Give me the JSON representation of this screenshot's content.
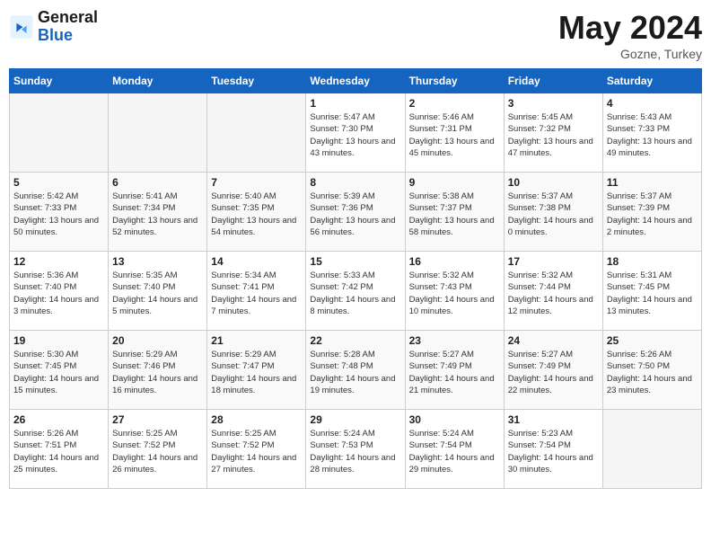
{
  "logo": {
    "general": "General",
    "blue": "Blue"
  },
  "title": {
    "month_year": "May 2024",
    "location": "Gozne, Turkey"
  },
  "days_of_week": [
    "Sunday",
    "Monday",
    "Tuesday",
    "Wednesday",
    "Thursday",
    "Friday",
    "Saturday"
  ],
  "weeks": [
    [
      {
        "day": "",
        "empty": true
      },
      {
        "day": "",
        "empty": true
      },
      {
        "day": "",
        "empty": true
      },
      {
        "day": "1",
        "sunrise": "Sunrise: 5:47 AM",
        "sunset": "Sunset: 7:30 PM",
        "daylight": "Daylight: 13 hours and 43 minutes."
      },
      {
        "day": "2",
        "sunrise": "Sunrise: 5:46 AM",
        "sunset": "Sunset: 7:31 PM",
        "daylight": "Daylight: 13 hours and 45 minutes."
      },
      {
        "day": "3",
        "sunrise": "Sunrise: 5:45 AM",
        "sunset": "Sunset: 7:32 PM",
        "daylight": "Daylight: 13 hours and 47 minutes."
      },
      {
        "day": "4",
        "sunrise": "Sunrise: 5:43 AM",
        "sunset": "Sunset: 7:33 PM",
        "daylight": "Daylight: 13 hours and 49 minutes."
      }
    ],
    [
      {
        "day": "5",
        "sunrise": "Sunrise: 5:42 AM",
        "sunset": "Sunset: 7:33 PM",
        "daylight": "Daylight: 13 hours and 50 minutes."
      },
      {
        "day": "6",
        "sunrise": "Sunrise: 5:41 AM",
        "sunset": "Sunset: 7:34 PM",
        "daylight": "Daylight: 13 hours and 52 minutes."
      },
      {
        "day": "7",
        "sunrise": "Sunrise: 5:40 AM",
        "sunset": "Sunset: 7:35 PM",
        "daylight": "Daylight: 13 hours and 54 minutes."
      },
      {
        "day": "8",
        "sunrise": "Sunrise: 5:39 AM",
        "sunset": "Sunset: 7:36 PM",
        "daylight": "Daylight: 13 hours and 56 minutes."
      },
      {
        "day": "9",
        "sunrise": "Sunrise: 5:38 AM",
        "sunset": "Sunset: 7:37 PM",
        "daylight": "Daylight: 13 hours and 58 minutes."
      },
      {
        "day": "10",
        "sunrise": "Sunrise: 5:37 AM",
        "sunset": "Sunset: 7:38 PM",
        "daylight": "Daylight: 14 hours and 0 minutes."
      },
      {
        "day": "11",
        "sunrise": "Sunrise: 5:37 AM",
        "sunset": "Sunset: 7:39 PM",
        "daylight": "Daylight: 14 hours and 2 minutes."
      }
    ],
    [
      {
        "day": "12",
        "sunrise": "Sunrise: 5:36 AM",
        "sunset": "Sunset: 7:40 PM",
        "daylight": "Daylight: 14 hours and 3 minutes."
      },
      {
        "day": "13",
        "sunrise": "Sunrise: 5:35 AM",
        "sunset": "Sunset: 7:40 PM",
        "daylight": "Daylight: 14 hours and 5 minutes."
      },
      {
        "day": "14",
        "sunrise": "Sunrise: 5:34 AM",
        "sunset": "Sunset: 7:41 PM",
        "daylight": "Daylight: 14 hours and 7 minutes."
      },
      {
        "day": "15",
        "sunrise": "Sunrise: 5:33 AM",
        "sunset": "Sunset: 7:42 PM",
        "daylight": "Daylight: 14 hours and 8 minutes."
      },
      {
        "day": "16",
        "sunrise": "Sunrise: 5:32 AM",
        "sunset": "Sunset: 7:43 PM",
        "daylight": "Daylight: 14 hours and 10 minutes."
      },
      {
        "day": "17",
        "sunrise": "Sunrise: 5:32 AM",
        "sunset": "Sunset: 7:44 PM",
        "daylight": "Daylight: 14 hours and 12 minutes."
      },
      {
        "day": "18",
        "sunrise": "Sunrise: 5:31 AM",
        "sunset": "Sunset: 7:45 PM",
        "daylight": "Daylight: 14 hours and 13 minutes."
      }
    ],
    [
      {
        "day": "19",
        "sunrise": "Sunrise: 5:30 AM",
        "sunset": "Sunset: 7:45 PM",
        "daylight": "Daylight: 14 hours and 15 minutes."
      },
      {
        "day": "20",
        "sunrise": "Sunrise: 5:29 AM",
        "sunset": "Sunset: 7:46 PM",
        "daylight": "Daylight: 14 hours and 16 minutes."
      },
      {
        "day": "21",
        "sunrise": "Sunrise: 5:29 AM",
        "sunset": "Sunset: 7:47 PM",
        "daylight": "Daylight: 14 hours and 18 minutes."
      },
      {
        "day": "22",
        "sunrise": "Sunrise: 5:28 AM",
        "sunset": "Sunset: 7:48 PM",
        "daylight": "Daylight: 14 hours and 19 minutes."
      },
      {
        "day": "23",
        "sunrise": "Sunrise: 5:27 AM",
        "sunset": "Sunset: 7:49 PM",
        "daylight": "Daylight: 14 hours and 21 minutes."
      },
      {
        "day": "24",
        "sunrise": "Sunrise: 5:27 AM",
        "sunset": "Sunset: 7:49 PM",
        "daylight": "Daylight: 14 hours and 22 minutes."
      },
      {
        "day": "25",
        "sunrise": "Sunrise: 5:26 AM",
        "sunset": "Sunset: 7:50 PM",
        "daylight": "Daylight: 14 hours and 23 minutes."
      }
    ],
    [
      {
        "day": "26",
        "sunrise": "Sunrise: 5:26 AM",
        "sunset": "Sunset: 7:51 PM",
        "daylight": "Daylight: 14 hours and 25 minutes."
      },
      {
        "day": "27",
        "sunrise": "Sunrise: 5:25 AM",
        "sunset": "Sunset: 7:52 PM",
        "daylight": "Daylight: 14 hours and 26 minutes."
      },
      {
        "day": "28",
        "sunrise": "Sunrise: 5:25 AM",
        "sunset": "Sunset: 7:52 PM",
        "daylight": "Daylight: 14 hours and 27 minutes."
      },
      {
        "day": "29",
        "sunrise": "Sunrise: 5:24 AM",
        "sunset": "Sunset: 7:53 PM",
        "daylight": "Daylight: 14 hours and 28 minutes."
      },
      {
        "day": "30",
        "sunrise": "Sunrise: 5:24 AM",
        "sunset": "Sunset: 7:54 PM",
        "daylight": "Daylight: 14 hours and 29 minutes."
      },
      {
        "day": "31",
        "sunrise": "Sunrise: 5:23 AM",
        "sunset": "Sunset: 7:54 PM",
        "daylight": "Daylight: 14 hours and 30 minutes."
      },
      {
        "day": "",
        "empty": true
      }
    ]
  ]
}
